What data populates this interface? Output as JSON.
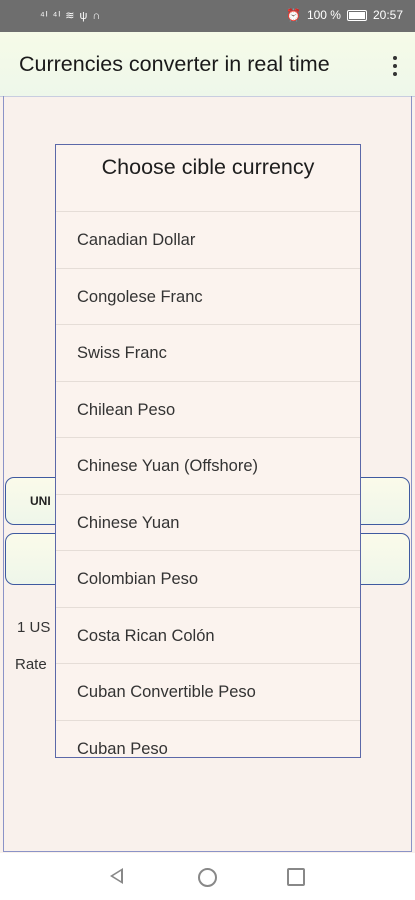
{
  "status_bar": {
    "left_icons": "⁴ᴵ ⁴ᴵ ≋ ψ ∩",
    "alarm_icon": "alarm-icon",
    "battery": "100 %",
    "time": "20:57"
  },
  "app_bar": {
    "title": "Currencies converter in real time"
  },
  "background": {
    "field_1_label": "UNI",
    "text_1": "1 US",
    "text_2": "Rate"
  },
  "dialog": {
    "title": "Choose cible currency",
    "items": [
      "Canadian Dollar",
      "Congolese Franc",
      "Swiss Franc",
      "Chilean Peso",
      "Chinese Yuan (Offshore)",
      "Chinese Yuan",
      "Colombian Peso",
      "Costa Rican Colón",
      "Cuban Convertible Peso",
      "Cuban Peso"
    ]
  }
}
